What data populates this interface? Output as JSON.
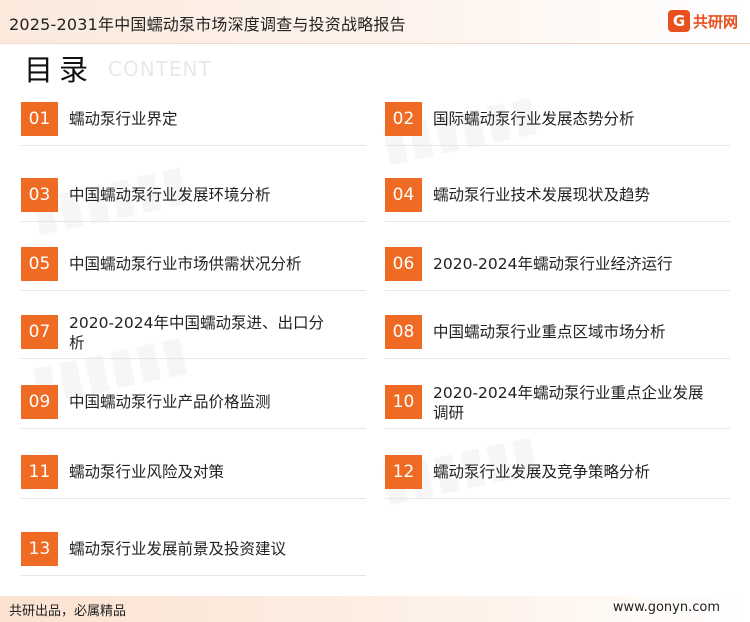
{
  "header": {
    "title": "2025-2031年中国蠕动泵市场深度调查与投资战略报告",
    "brand_mark": "G",
    "brand_name": "共研网"
  },
  "toc": {
    "title": "目录",
    "subtitle": "CONTENT"
  },
  "items": [
    {
      "num": "01",
      "label": "蠕动泵行业界定"
    },
    {
      "num": "02",
      "label": "国际蠕动泵行业发展态势分析"
    },
    {
      "num": "03",
      "label": "中国蠕动泵行业发展环境分析"
    },
    {
      "num": "04",
      "label": "蠕动泵行业技术发展现状及趋势"
    },
    {
      "num": "05",
      "label": "中国蠕动泵行业市场供需状况分析"
    },
    {
      "num": "06",
      "label": "2020-2024年蠕动泵行业经济运行"
    },
    {
      "num": "07",
      "label": "2020-2024年中国蠕动泵进、出口分析"
    },
    {
      "num": "08",
      "label": "中国蠕动泵行业重点区域市场分析"
    },
    {
      "num": "09",
      "label": "中国蠕动泵行业产品价格监测"
    },
    {
      "num": "10",
      "label": "2020-2024年蠕动泵行业重点企业发展调研"
    },
    {
      "num": "11",
      "label": "蠕动泵行业风险及对策"
    },
    {
      "num": "12",
      "label": "蠕动泵行业发展及竞争策略分析"
    },
    {
      "num": "13",
      "label": "蠕动泵行业发展前景及投资建议"
    }
  ],
  "footer": {
    "left": "共研出品，必属精品",
    "right": "www.gonyn.com"
  },
  "colors": {
    "accent": "#ef6a22",
    "brand": "#e8501e"
  }
}
